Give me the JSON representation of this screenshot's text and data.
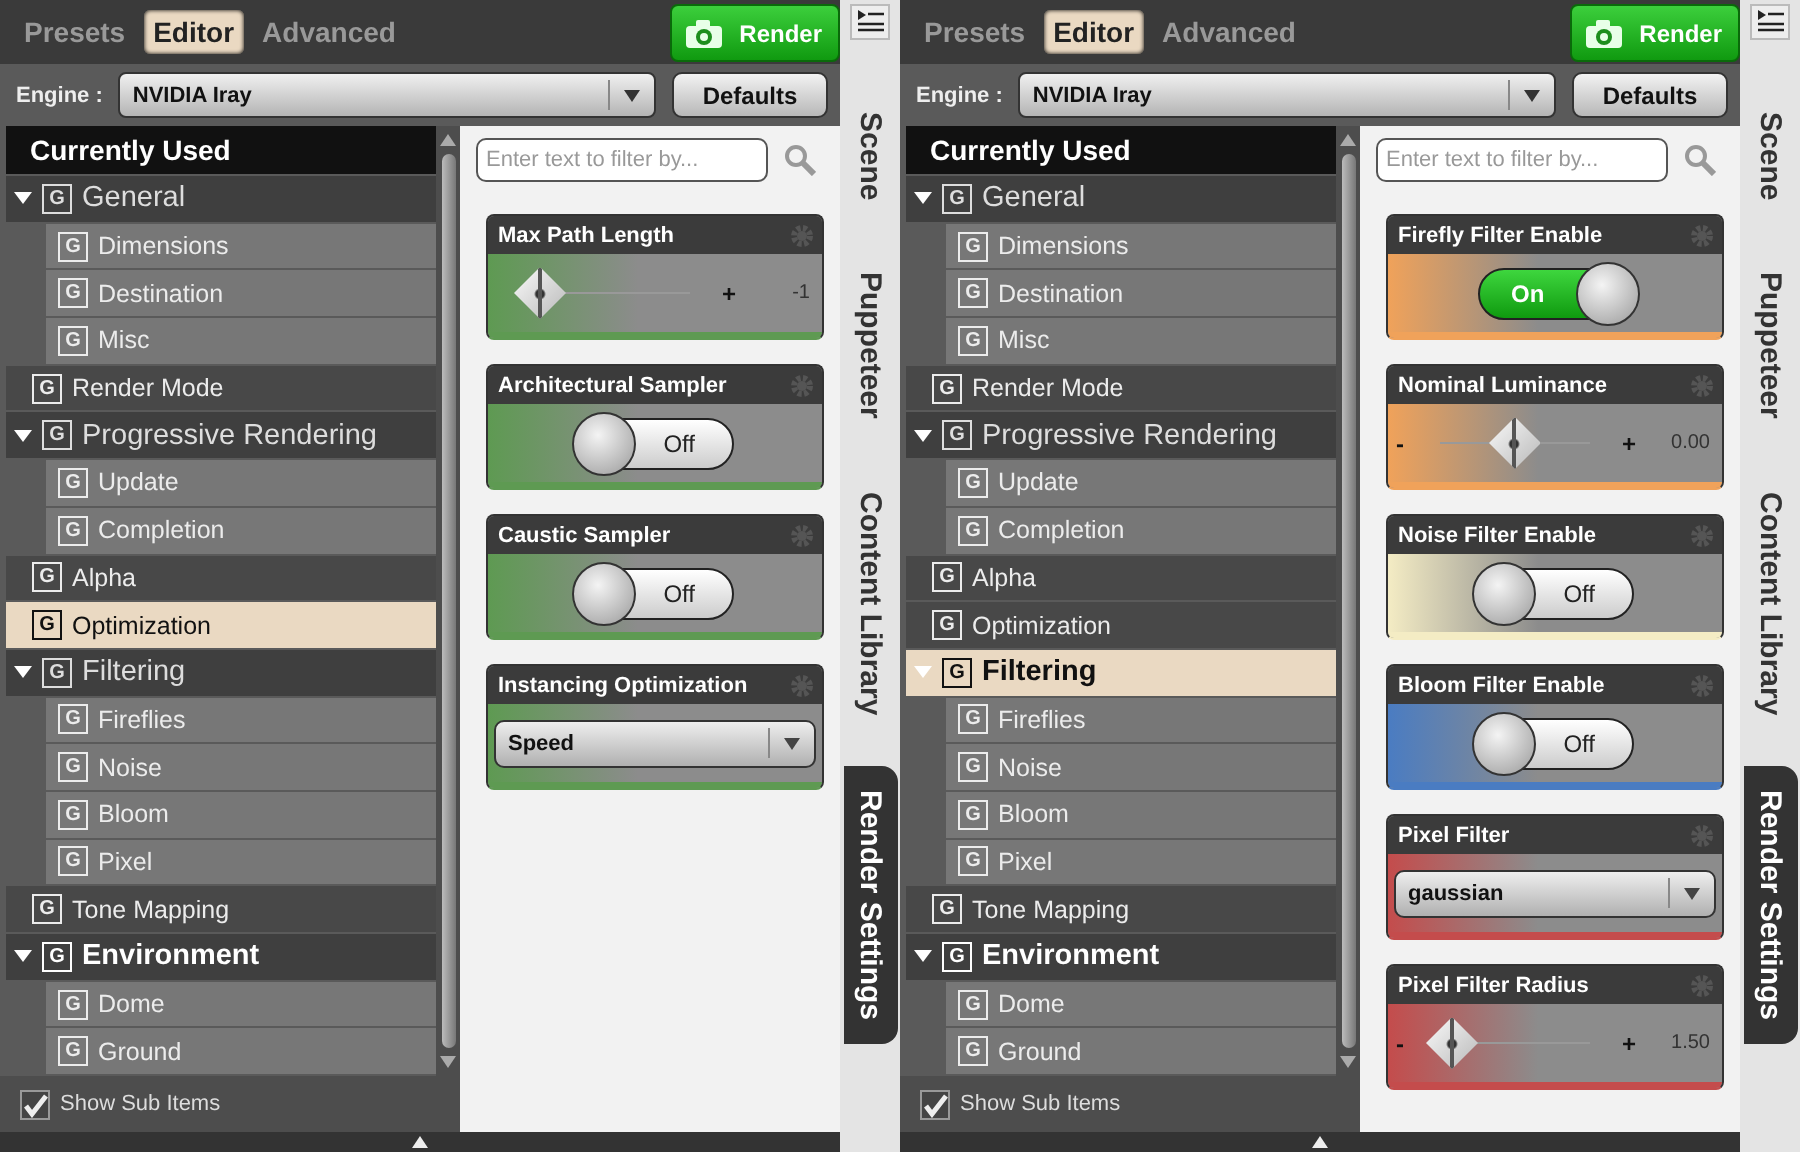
{
  "panels": [
    {
      "tabs": [
        {
          "label": "Presets",
          "selected": false
        },
        {
          "label": "Editor",
          "selected": true
        },
        {
          "label": "Advanced",
          "selected": false
        }
      ],
      "render_button": "Render",
      "engine_label": "Engine :",
      "engine": "NVIDIA Iray",
      "defaults_button": "Defaults",
      "tree_header": "Currently Used",
      "tree": [
        {
          "badge": "G",
          "label": "General",
          "bold": false,
          "expanded": true,
          "selected": false,
          "children": [
            {
              "badge": "G",
              "label": "Dimensions",
              "selected": false
            },
            {
              "badge": "G",
              "label": "Destination",
              "selected": false
            },
            {
              "badge": "G",
              "label": "Misc",
              "selected": false
            }
          ]
        },
        {
          "badge": "G",
          "label": "Render Mode",
          "selected": false
        },
        {
          "badge": "G",
          "label": "Progressive Rendering",
          "bold": false,
          "expanded": true,
          "selected": false,
          "children": [
            {
              "badge": "G",
              "label": "Update",
              "selected": false
            },
            {
              "badge": "G",
              "label": "Completion",
              "selected": false
            }
          ]
        },
        {
          "badge": "G",
          "label": "Alpha",
          "selected": false
        },
        {
          "badge": "G",
          "label": "Optimization",
          "selected": true
        },
        {
          "badge": "G",
          "label": "Filtering",
          "bold": false,
          "expanded": true,
          "selected": false,
          "children": [
            {
              "badge": "G",
              "label": "Fireflies",
              "selected": false
            },
            {
              "badge": "G",
              "label": "Noise",
              "selected": false
            },
            {
              "badge": "G",
              "label": "Bloom",
              "selected": false
            },
            {
              "badge": "G",
              "label": "Pixel",
              "selected": false
            }
          ]
        },
        {
          "badge": "G",
          "label": "Tone Mapping",
          "selected": false
        },
        {
          "badge": "G",
          "label": "Environment",
          "bold": true,
          "expanded": true,
          "selected": false,
          "children": [
            {
              "badge": "G",
              "label": "Dome",
              "selected": false
            },
            {
              "badge": "G",
              "label": "Ground",
              "selected": false
            }
          ]
        }
      ],
      "filter": {
        "placeholder": "Enter text to filter by..."
      },
      "cards": [
        {
          "kind": "slider",
          "title": "Max Path Length",
          "color": "#5e9a52",
          "level": 0,
          "plus": "+",
          "reading": "-1"
        },
        {
          "kind": "toggle",
          "title": "Architectural Sampler",
          "color": "#5e9a52",
          "on": false,
          "label": "Off"
        },
        {
          "kind": "toggle",
          "title": "Caustic Sampler",
          "color": "#5e9a52",
          "on": false,
          "label": "Off"
        },
        {
          "kind": "dropdown",
          "title": "Instancing Optimization",
          "color": "#5e9a52",
          "value": "Speed"
        }
      ],
      "show_sub_items": {
        "label": "Show Sub Items",
        "checked": true
      },
      "side_tabs": [
        {
          "label": "Scene",
          "selected": false
        },
        {
          "label": "Puppeteer",
          "selected": false
        },
        {
          "label": "Content Library",
          "selected": false
        },
        {
          "label": "Render Settings",
          "selected": true
        }
      ]
    },
    {
      "tabs": [
        {
          "label": "Presets",
          "selected": false
        },
        {
          "label": "Editor",
          "selected": true
        },
        {
          "label": "Advanced",
          "selected": false
        }
      ],
      "render_button": "Render",
      "engine_label": "Engine :",
      "engine": "NVIDIA Iray",
      "defaults_button": "Defaults",
      "tree_header": "Currently Used",
      "tree": [
        {
          "badge": "G",
          "label": "General",
          "bold": false,
          "expanded": true,
          "selected": false,
          "children": [
            {
              "badge": "G",
              "label": "Dimensions",
              "selected": false
            },
            {
              "badge": "G",
              "label": "Destination",
              "selected": false
            },
            {
              "badge": "G",
              "label": "Misc",
              "selected": false
            }
          ]
        },
        {
          "badge": "G",
          "label": "Render Mode",
          "selected": false
        },
        {
          "badge": "G",
          "label": "Progressive Rendering",
          "bold": false,
          "expanded": true,
          "selected": false,
          "children": [
            {
              "badge": "G",
              "label": "Update",
              "selected": false
            },
            {
              "badge": "G",
              "label": "Completion",
              "selected": false
            }
          ]
        },
        {
          "badge": "G",
          "label": "Alpha",
          "selected": false
        },
        {
          "badge": "G",
          "label": "Optimization",
          "selected": false
        },
        {
          "badge": "G",
          "label": "Filtering",
          "bold": true,
          "expanded": true,
          "selected": true,
          "children": [
            {
              "badge": "G",
              "label": "Fireflies",
              "selected": false
            },
            {
              "badge": "G",
              "label": "Noise",
              "selected": false
            },
            {
              "badge": "G",
              "label": "Bloom",
              "selected": false
            },
            {
              "badge": "G",
              "label": "Pixel",
              "selected": false
            }
          ]
        },
        {
          "badge": "G",
          "label": "Tone Mapping",
          "selected": false
        },
        {
          "badge": "G",
          "label": "Environment",
          "bold": true,
          "expanded": true,
          "selected": false,
          "children": [
            {
              "badge": "G",
              "label": "Dome",
              "selected": false
            },
            {
              "badge": "G",
              "label": "Ground",
              "selected": false
            }
          ]
        }
      ],
      "filter": {
        "placeholder": "Enter text to filter by..."
      },
      "cards": [
        {
          "kind": "toggle",
          "title": "Firefly Filter Enable",
          "color": "#f0a25a",
          "on": true,
          "label": "On"
        },
        {
          "kind": "slider",
          "title": "Nominal Luminance",
          "color": "#f0a25a",
          "level": 0.5,
          "minus": "-",
          "plus": "+",
          "reading": "0.00"
        },
        {
          "kind": "toggle",
          "title": "Noise Filter Enable",
          "color": "#f4ecc4",
          "on": false,
          "label": "Off"
        },
        {
          "kind": "toggle",
          "title": "Bloom Filter Enable",
          "color": "#4a7cc2",
          "on": false,
          "label": "Off"
        },
        {
          "kind": "dropdown",
          "title": "Pixel Filter",
          "color": "#c44c4c",
          "value": "gaussian"
        },
        {
          "kind": "slider",
          "title": "Pixel Filter Radius",
          "color": "#c44c4c",
          "level": 0.08,
          "minus": "-",
          "plus": "+",
          "reading": "1.50"
        }
      ],
      "show_sub_items": {
        "label": "Show Sub Items",
        "checked": true
      },
      "side_tabs": [
        {
          "label": "Scene",
          "selected": false
        },
        {
          "label": "Puppeteer",
          "selected": false
        },
        {
          "label": "Content Library",
          "selected": false
        },
        {
          "label": "Render Settings",
          "selected": true
        }
      ]
    }
  ]
}
